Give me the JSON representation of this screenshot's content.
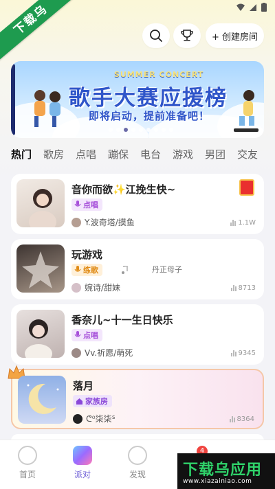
{
  "watermark": {
    "text": "下载乌"
  },
  "header": {
    "create_room_label": "+ 创建房间"
  },
  "banner": {
    "subtitle_en": "SUMMER CONCERT",
    "title": "歌手大赛应援榜",
    "subtitle": "即将启动，提前准备吧！"
  },
  "tabs": [
    "热门",
    "歌房",
    "点唱",
    "蹦保",
    "电台",
    "游戏",
    "男团",
    "交友"
  ],
  "rooms": [
    {
      "name": "音你而欲✨江挽生快~",
      "tag": "点唱",
      "host": "Y.波奇塔/摸鱼",
      "count": "1.1W",
      "tag_color": "#a64fd9",
      "tag_bg": "#f3e6fc"
    },
    {
      "name": "玩游戏",
      "tag": "练歌",
      "host": "婉诗/甜妹",
      "count": "8713",
      "extra": "丹正母子",
      "tag_color": "#e08b16",
      "tag_bg": "#fff0d9"
    },
    {
      "name": "香奈儿~十一生日快乐",
      "tag": "点唱",
      "host": "Vv.祈愿/萌死",
      "count": "9345",
      "tag_color": "#a64fd9",
      "tag_bg": "#f3e6fc"
    },
    {
      "name": "落月",
      "tag": "家族房",
      "host": "ᕦ⁰柒柒ᔆ",
      "count": "8364",
      "tag_color": "#8a47d8",
      "tag_bg": "#efe3fb"
    }
  ],
  "nav": [
    {
      "label": "首页"
    },
    {
      "label": "派对"
    },
    {
      "label": "发现"
    }
  ],
  "nav_badge": "4",
  "ad_logo": {
    "title": "下载乌应用",
    "url": "www.xiazainiao.com"
  }
}
